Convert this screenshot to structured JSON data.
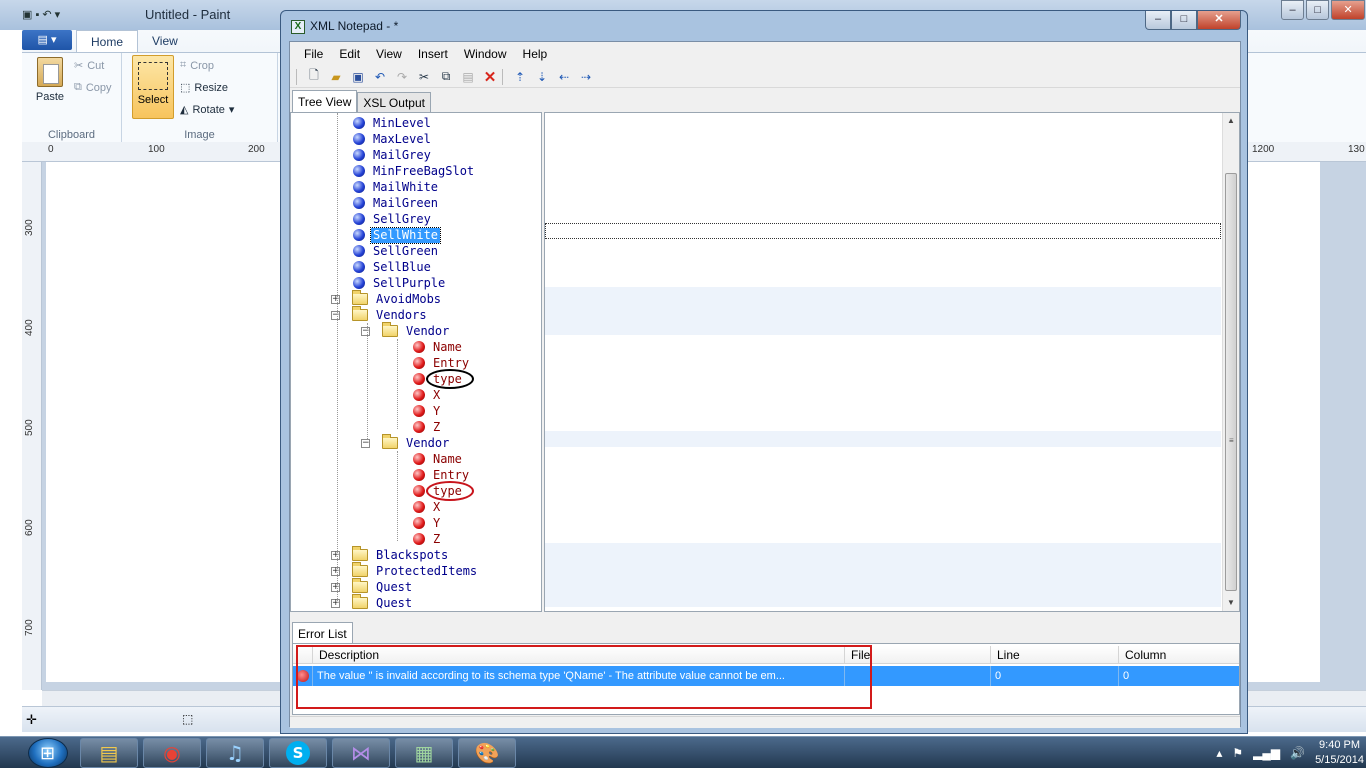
{
  "paint": {
    "title": "Untitled - Paint",
    "file_tab": "▤ ▾",
    "tabs": [
      "Home",
      "View"
    ],
    "clipboard": {
      "paste": "Paste",
      "cut": "Cut",
      "copy": "Copy",
      "label": "Clipboard"
    },
    "image": {
      "select": "Select",
      "crop": "Crop",
      "resize": "Resize",
      "rotate": "Rotate",
      "label": "Image"
    },
    "ruler_ticks": [
      "0",
      "100",
      "200",
      "1200",
      "130"
    ],
    "vruler_ticks": [
      "300",
      "400",
      "500",
      "600",
      "700"
    ],
    "window_controls": [
      "–",
      "□",
      "✕"
    ]
  },
  "xml": {
    "title": "XML Notepad - *",
    "window_controls": {
      "minimize": "–",
      "maximize": "□",
      "close": "✕"
    },
    "menu": [
      "File",
      "Edit",
      "View",
      "Insert",
      "Window",
      "Help"
    ],
    "toolbar_icons": [
      "new-icon",
      "open-icon",
      "save-icon",
      "undo-icon",
      "redo-icon",
      "cut-icon",
      "copy-icon",
      "paste-icon",
      "delete-icon",
      "nudge-up-icon",
      "nudge-down-icon",
      "nudge-left-icon",
      "nudge-right-icon"
    ],
    "tabs": [
      "Tree View",
      "XSL Output"
    ],
    "tree": [
      {
        "label": "MinLevel",
        "kind": "attr-blue"
      },
      {
        "label": "MaxLevel",
        "kind": "attr-blue"
      },
      {
        "label": "MailGrey",
        "kind": "attr-blue"
      },
      {
        "label": "MinFreeBagSlot",
        "kind": "attr-blue"
      },
      {
        "label": "MailWhite",
        "kind": "attr-blue"
      },
      {
        "label": "MailGreen",
        "kind": "attr-blue"
      },
      {
        "label": "SellGrey",
        "kind": "attr-blue"
      },
      {
        "label": "SellWhite",
        "kind": "attr-blue",
        "selected": true
      },
      {
        "label": "SellGreen",
        "kind": "attr-blue"
      },
      {
        "label": "SellBlue",
        "kind": "attr-blue"
      },
      {
        "label": "SellPurple",
        "kind": "attr-blue"
      },
      {
        "label": "AvoidMobs",
        "kind": "folder-collapsed"
      },
      {
        "label": "Vendors",
        "kind": "folder-expanded"
      },
      {
        "label": "Vendor",
        "kind": "folder-expanded"
      },
      {
        "label": "Name",
        "kind": "attr-red"
      },
      {
        "label": "Entry",
        "kind": "attr-red"
      },
      {
        "label": "type",
        "kind": "attr-red",
        "circled": "black"
      },
      {
        "label": "X",
        "kind": "attr-red"
      },
      {
        "label": "Y",
        "kind": "attr-red"
      },
      {
        "label": "Z",
        "kind": "attr-red"
      },
      {
        "label": "Vendor",
        "kind": "folder-expanded"
      },
      {
        "label": "Name",
        "kind": "attr-red"
      },
      {
        "label": "Entry",
        "kind": "attr-red"
      },
      {
        "label": "type",
        "kind": "attr-red",
        "circled": "red"
      },
      {
        "label": "X",
        "kind": "attr-red"
      },
      {
        "label": "Y",
        "kind": "attr-red"
      },
      {
        "label": "Z",
        "kind": "attr-red"
      },
      {
        "label": "Blackspots",
        "kind": "folder-collapsed"
      },
      {
        "label": "ProtectedItems",
        "kind": "folder-collapsed"
      },
      {
        "label": "Quest",
        "kind": "folder-collapsed"
      },
      {
        "label": "Quest",
        "kind": "folder-collapsed"
      }
    ],
    "error_list": {
      "tab": "Error List",
      "columns": [
        "Description",
        "File",
        "Line",
        "Column"
      ],
      "rows": [
        {
          "description": "The value '' is invalid according to its schema type 'QName' - The attribute value cannot be em...",
          "file": "",
          "line": "0",
          "column": "0"
        }
      ]
    }
  },
  "taskbar": {
    "apps": [
      "explorer-icon",
      "chrome-icon",
      "itunes-icon",
      "skype-icon",
      "visual-studio-icon",
      "xml-notepad-icon",
      "paint-icon"
    ],
    "time": "9:40 PM",
    "date": "5/15/2014"
  }
}
